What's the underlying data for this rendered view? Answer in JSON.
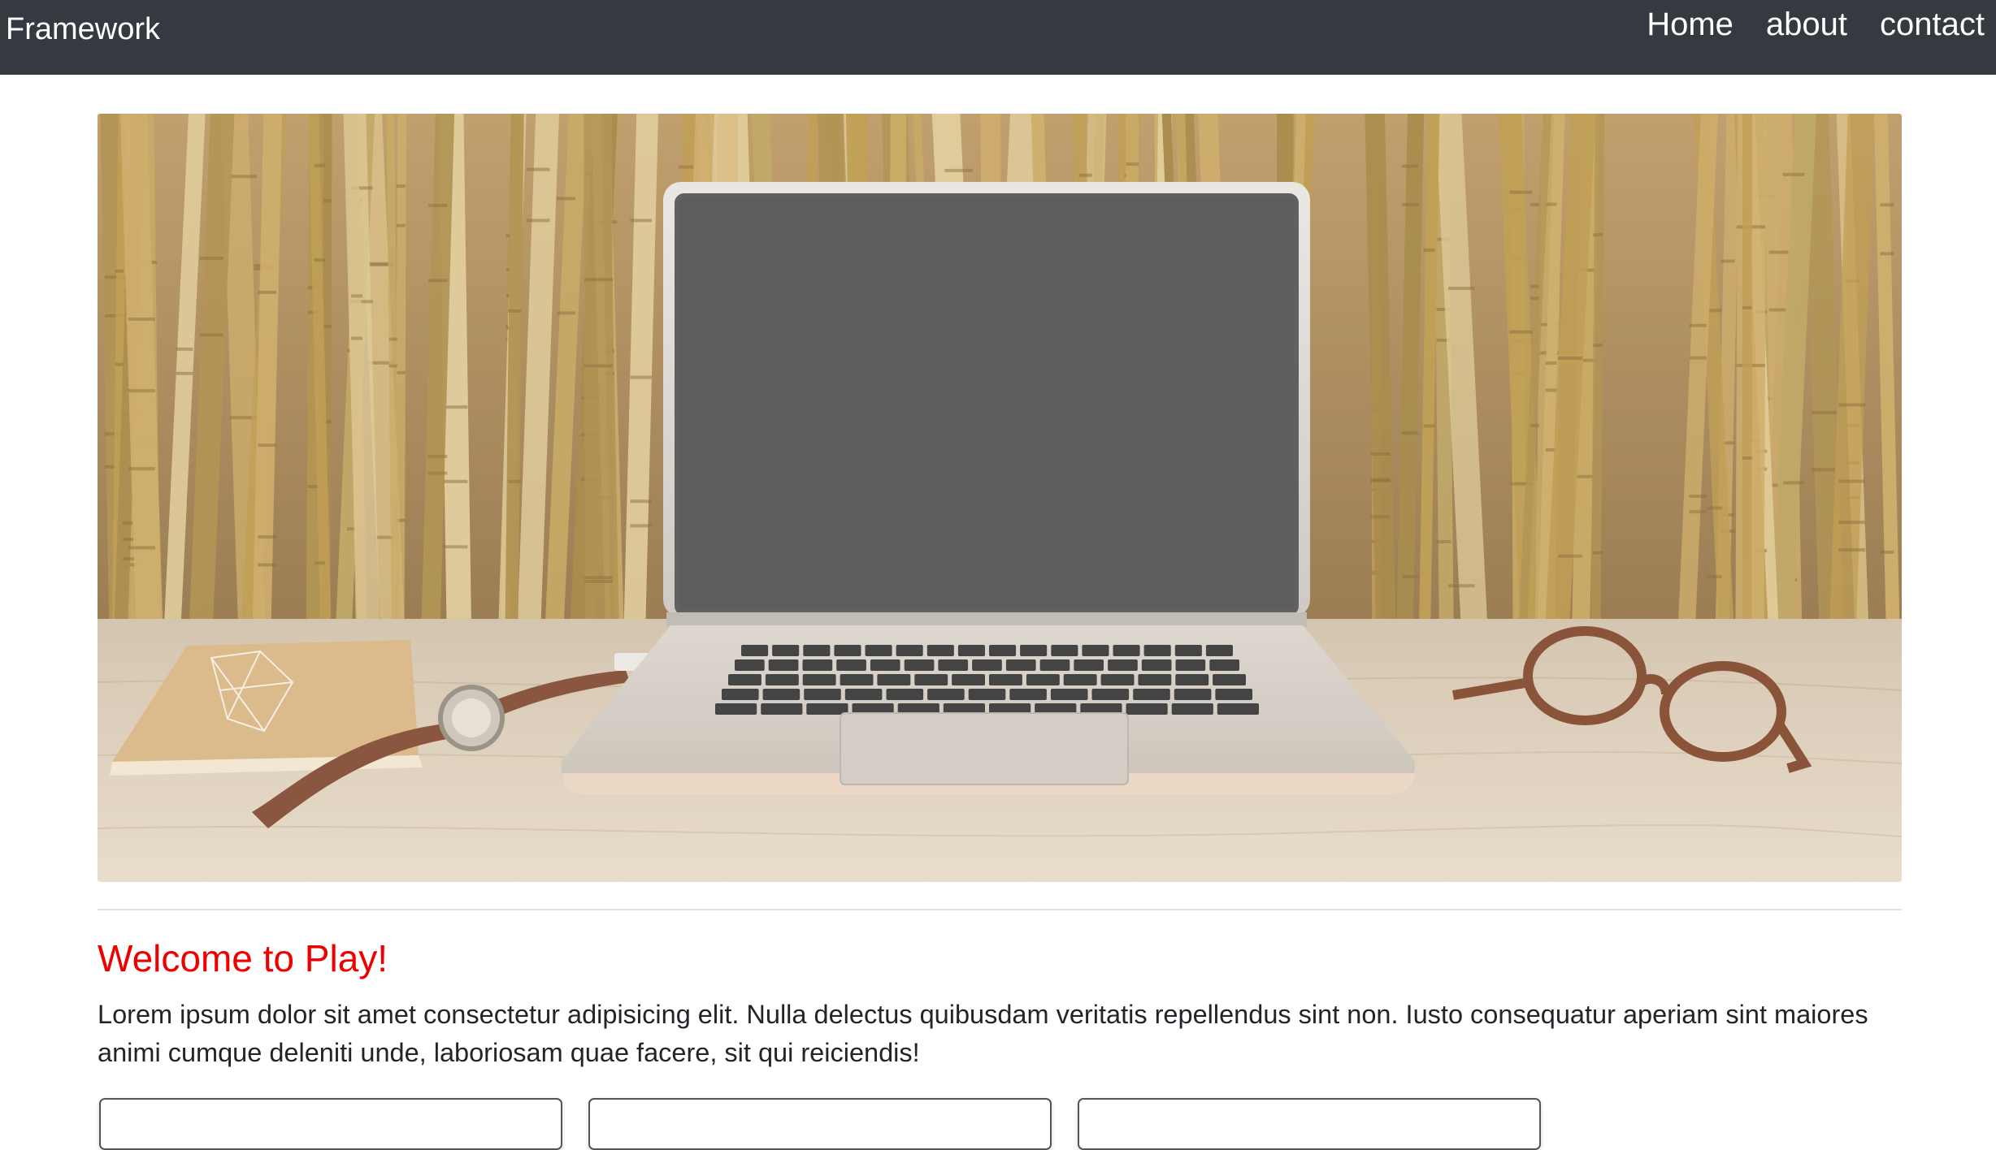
{
  "navbar": {
    "brand": "Framework",
    "links": [
      {
        "label": "Home"
      },
      {
        "label": "about"
      },
      {
        "label": "contact"
      }
    ]
  },
  "main": {
    "headline": "Welcome to Play!",
    "paragraph": "Lorem ipsum dolor sit amet consectetur adipisicing elit. Nulla delectus quibusdam veritatis repellendus sint non. Iusto consequatur aperiam sint maiores animi cumque deleniti unde, laboriosam quae facere, sit qui reiciendis!"
  },
  "colors": {
    "navbar_bg": "#343a40",
    "headline": "#ee0000",
    "text": "#212529"
  }
}
